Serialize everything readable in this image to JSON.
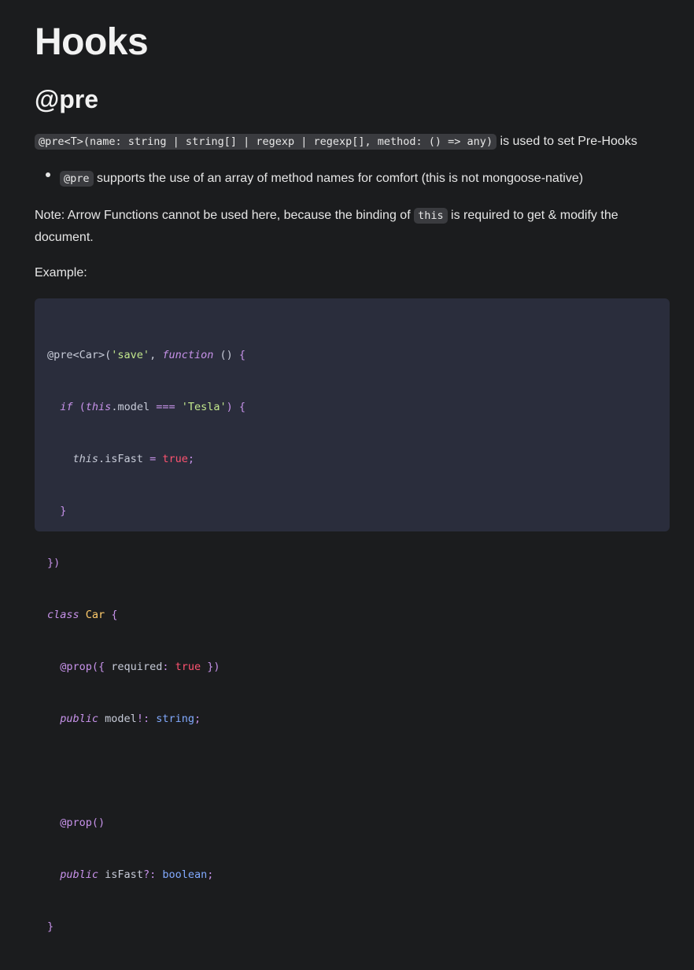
{
  "title": "Hooks",
  "section": "@pre",
  "signature": "@pre<T>(name: string | string[] | regexp | regexp[], method: () => any)",
  "signature_suffix": " is used to set Pre-Hooks",
  "bullet": {
    "code": "@pre",
    "text": " supports the use of an array of method names for comfort (this is not mongoose-native)"
  },
  "note": {
    "before": "Note: Arrow Functions cannot be used here, because the binding of ",
    "code": "this",
    "after": " is required to get & modify the",
    "line2": "document."
  },
  "example_label": "Example:",
  "code": {
    "l1": {
      "a": "@pre<Car>(",
      "b": "'save'",
      "c": ", ",
      "d": "function",
      "e": " () ",
      "f": "{"
    },
    "l2": {
      "a": "  ",
      "b": "if",
      "c": " (",
      "d": "this",
      "e": ".model ",
      "f": "===",
      "g": " ",
      "h": "'Tesla'",
      "i": ") ",
      "j": "{"
    },
    "l3": {
      "a": "    ",
      "b": "this",
      "c": ".isFast ",
      "d": "=",
      "e": " ",
      "f": "true",
      "g": ";"
    },
    "l4": {
      "a": "  ",
      "b": "}"
    },
    "l5": {
      "a": "})"
    },
    "l6": {
      "a": "class",
      "b": " ",
      "c": "Car",
      "d": " ",
      "e": "{"
    },
    "l7": {
      "a": "  ",
      "b": "@prop",
      "c": "({",
      "d": " required",
      "e": ": ",
      "f": "true",
      "g": " })"
    },
    "l8": {
      "a": "  ",
      "b": "public",
      "c": " model",
      "d": "!: ",
      "e": "string",
      "f": ";"
    },
    "l9": {
      "a": ""
    },
    "l10": {
      "a": "  ",
      "b": "@prop",
      "c": "()"
    },
    "l11": {
      "a": "  ",
      "b": "public",
      "c": " isFast",
      "d": "?: ",
      "e": "boolean",
      "f": ";"
    },
    "l12": {
      "a": "}"
    }
  }
}
